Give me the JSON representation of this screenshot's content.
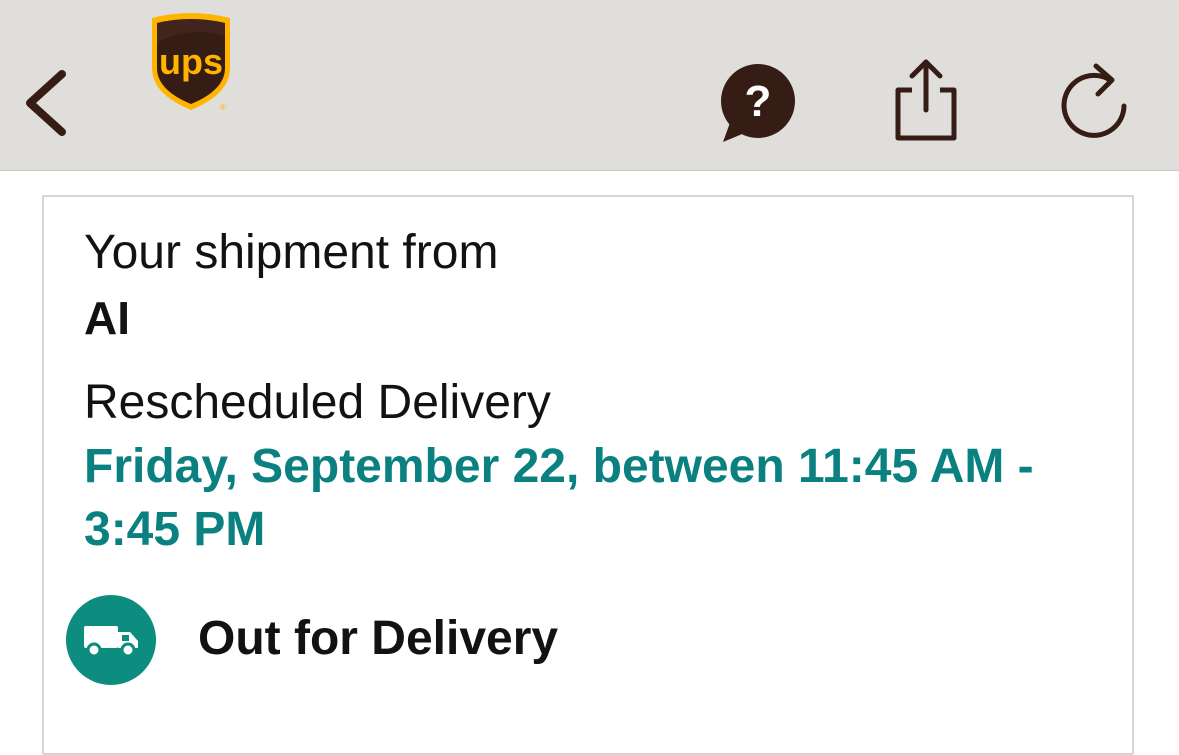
{
  "nav": {
    "back_icon": "chevron-left-icon",
    "logo_text": "ups",
    "help_icon": "help-bubble-icon",
    "share_icon": "share-icon",
    "refresh_icon": "refresh-icon",
    "colors": {
      "nav_background": "#e0deda",
      "icon_color": "#351c15",
      "ups_gold": "#ffb500",
      "ups_brown": "#351c15"
    }
  },
  "shipment": {
    "from_label": "Your shipment from",
    "sender": "AI",
    "delivery_label": "Rescheduled Delivery",
    "delivery_window": "Friday, September 22, between 11:45 AM - 3:45 PM",
    "status": "Out for Delivery",
    "status_icon": "delivery-truck-icon",
    "colors": {
      "accent": "#0a8080",
      "status_icon_bg": "#0d8c80"
    }
  }
}
